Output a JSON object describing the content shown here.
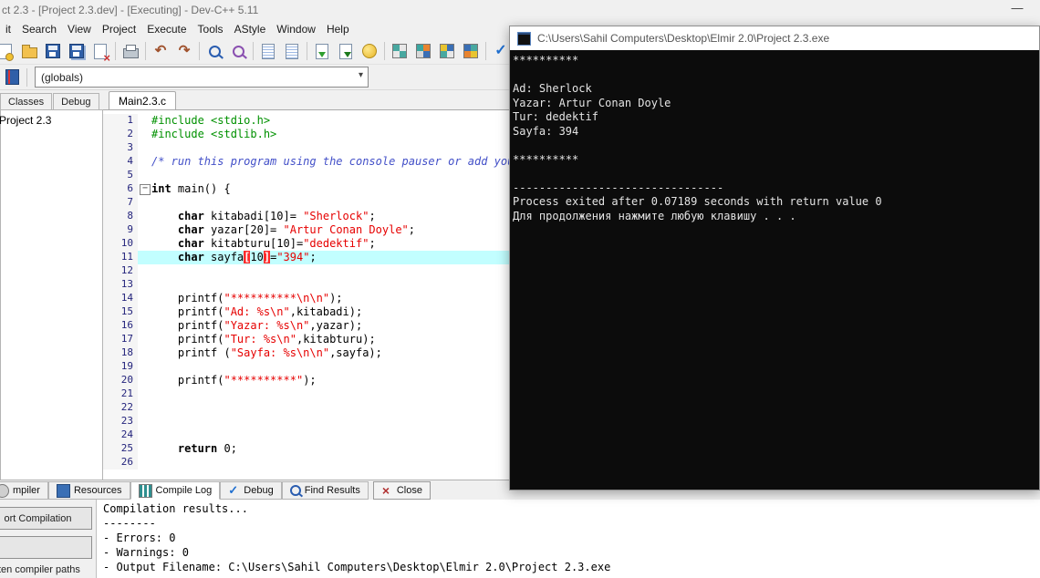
{
  "window": {
    "title": "ct 2.3 - [Project 2.3.dev] - [Executing] - Dev-C++ 5.11",
    "minimize_glyph": "—"
  },
  "icons": {
    "undo": "↶",
    "redo": "↷",
    "check": "✓",
    "close_x": "×",
    "combo_arrow": "▾",
    "fold_minus": "−"
  },
  "menubar": {
    "items": [
      "it",
      "Search",
      "View",
      "Project",
      "Execute",
      "Tools",
      "AStyle",
      "Window",
      "Help"
    ]
  },
  "toolbar2": {
    "globals_value": "(globals)"
  },
  "left_panel": {
    "tabs": [
      "Classes",
      "Debug"
    ],
    "tree_root": "Project 2.3"
  },
  "editor": {
    "tab": "Main2.3.c",
    "active_line": 11,
    "lines": [
      {
        "n": 1,
        "t": [
          [
            "pp",
            "#include <stdio.h>"
          ]
        ]
      },
      {
        "n": 2,
        "t": [
          [
            "pp",
            "#include <stdlib.h>"
          ]
        ]
      },
      {
        "n": 3,
        "t": []
      },
      {
        "n": 4,
        "t": [
          [
            "cmt",
            "/* run this program using the console pauser or add your"
          ]
        ]
      },
      {
        "n": 5,
        "t": []
      },
      {
        "n": 6,
        "fold": true,
        "t": [
          [
            "kw",
            "int"
          ],
          [
            "pln",
            " main() {"
          ]
        ]
      },
      {
        "n": 7,
        "t": []
      },
      {
        "n": 8,
        "t": [
          [
            "pln",
            "    "
          ],
          [
            "kw",
            "char"
          ],
          [
            "pln",
            " kitabadi[10]= "
          ],
          [
            "str",
            "\"Sherlock\""
          ],
          [
            "pln",
            ";"
          ]
        ]
      },
      {
        "n": 9,
        "t": [
          [
            "pln",
            "    "
          ],
          [
            "kw",
            "char"
          ],
          [
            "pln",
            " yazar[20]= "
          ],
          [
            "str",
            "\"Artur Conan Doyle\""
          ],
          [
            "pln",
            ";"
          ]
        ]
      },
      {
        "n": 10,
        "t": [
          [
            "pln",
            "    "
          ],
          [
            "kw",
            "char"
          ],
          [
            "pln",
            " kitabturu[10]="
          ],
          [
            "str",
            "\"dedektif\""
          ],
          [
            "pln",
            ";"
          ]
        ]
      },
      {
        "n": 11,
        "t": [
          [
            "pln",
            "    "
          ],
          [
            "kw",
            "char"
          ],
          [
            "pln",
            " sayfa"
          ],
          [
            "brk",
            "["
          ],
          [
            "pln",
            "10"
          ],
          [
            "brk",
            "]"
          ],
          [
            "pln",
            "="
          ],
          [
            "str",
            "\"394\""
          ],
          [
            "pln",
            ";"
          ]
        ]
      },
      {
        "n": 12,
        "t": []
      },
      {
        "n": 13,
        "t": []
      },
      {
        "n": 14,
        "t": [
          [
            "pln",
            "    printf("
          ],
          [
            "str",
            "\"**********\\n\\n\""
          ],
          [
            "pln",
            ");"
          ]
        ]
      },
      {
        "n": 15,
        "t": [
          [
            "pln",
            "    printf("
          ],
          [
            "str",
            "\"Ad: %s\\n\""
          ],
          [
            "pln",
            ",kitabadi);"
          ]
        ]
      },
      {
        "n": 16,
        "t": [
          [
            "pln",
            "    printf("
          ],
          [
            "str",
            "\"Yazar: %s\\n\""
          ],
          [
            "pln",
            ",yazar);"
          ]
        ]
      },
      {
        "n": 17,
        "t": [
          [
            "pln",
            "    printf("
          ],
          [
            "str",
            "\"Tur: %s\\n\""
          ],
          [
            "pln",
            ",kitabturu);"
          ]
        ]
      },
      {
        "n": 18,
        "t": [
          [
            "pln",
            "    printf ("
          ],
          [
            "str",
            "\"Sayfa: %s\\n\\n\""
          ],
          [
            "pln",
            ",sayfa);"
          ]
        ]
      },
      {
        "n": 19,
        "t": []
      },
      {
        "n": 20,
        "t": [
          [
            "pln",
            "    printf("
          ],
          [
            "str",
            "\"**********\""
          ],
          [
            "pln",
            ");"
          ]
        ]
      },
      {
        "n": 21,
        "t": []
      },
      {
        "n": 22,
        "t": []
      },
      {
        "n": 23,
        "t": []
      },
      {
        "n": 24,
        "t": []
      },
      {
        "n": 25,
        "t": [
          [
            "pln",
            "    "
          ],
          [
            "kw",
            "return"
          ],
          [
            "pln",
            " 0;"
          ]
        ]
      },
      {
        "n": 26,
        "t": []
      }
    ]
  },
  "bottom_tabs": {
    "items": [
      {
        "label": "mpiler",
        "icon": "compiler",
        "active": false,
        "button": false
      },
      {
        "label": "Resources",
        "icon": "resources",
        "active": false,
        "button": false
      },
      {
        "label": "Compile Log",
        "icon": "compile-log",
        "active": true,
        "button": false
      },
      {
        "label": "Debug",
        "icon": "debug",
        "active": false,
        "button": false
      },
      {
        "label": "Find Results",
        "icon": "find",
        "active": false,
        "button": false
      },
      {
        "label": "Close",
        "icon": "close",
        "active": false,
        "button": true
      }
    ]
  },
  "left_bottom": {
    "abort_button": "ort Compilation",
    "extra_button": "",
    "paths_label": "ten compiler paths"
  },
  "compile_log": {
    "lines": [
      "Compilation results...",
      "--------",
      "- Errors: 0",
      "- Warnings: 0",
      "- Output Filename: C:\\Users\\Sahil Computers\\Desktop\\Elmir 2.0\\Project 2.3.exe"
    ]
  },
  "console": {
    "title": "C:\\Users\\Sahil Computers\\Desktop\\Elmir 2.0\\Project 2.3.exe",
    "lines": [
      "**********",
      "",
      "Ad: Sherlock",
      "Yazar: Artur Conan Doyle",
      "Tur: dedektif",
      "Sayfa: 394",
      "",
      "**********",
      "",
      "--------------------------------",
      "Process exited after 0.07189 seconds with return value 0",
      "Для продолжения нажмите любую клавишу . . ."
    ]
  },
  "colors": {
    "active_line_bg": "#c2feff",
    "string_red": "#e60000",
    "preprocessor_green": "#009100",
    "comment_blue": "#4350c8",
    "bracket_match_red": "#ff2b2b",
    "console_bg": "#0c0c0c",
    "console_text": "#e4e4e4",
    "accent_blue": "#2f5fa8"
  }
}
